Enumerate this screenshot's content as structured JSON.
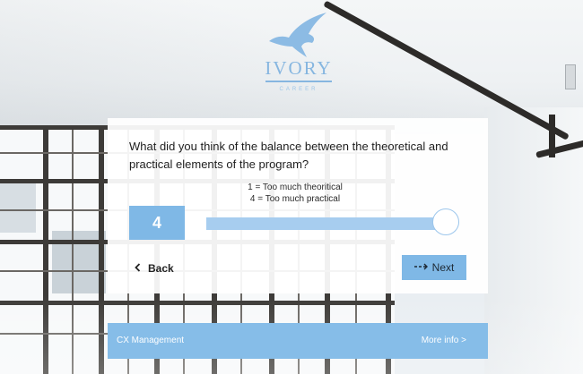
{
  "brand": {
    "name": "IVORY",
    "subtitle": "CAREER",
    "logo_icon": "bird-icon",
    "accent_color": "#86b6e0"
  },
  "survey": {
    "question": "What did you think of the balance between the theoretical and practical elements of the program?",
    "scale_min_hint": "1 = Too much theoritical",
    "scale_max_hint": "4 = Too much practical",
    "selected_value": "4",
    "slider": {
      "min": 1,
      "max": 4,
      "value": 4
    },
    "back_label": "Back",
    "next_label": "Next",
    "back_icon": "chevron-left-icon",
    "next_icon": "arrow-right-icon",
    "button_color": "#7fb8e6"
  },
  "footer": {
    "left_text": "CX Management",
    "right_text": "More info >"
  }
}
